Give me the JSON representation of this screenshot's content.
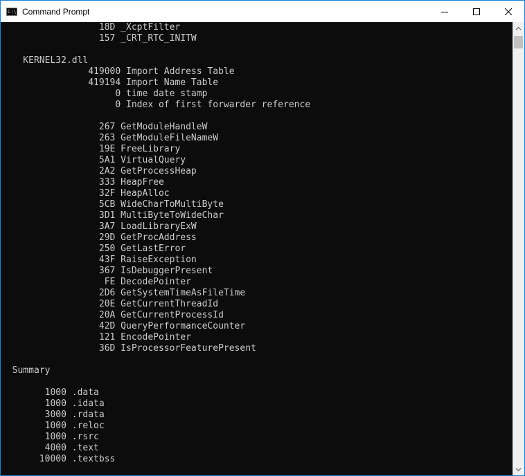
{
  "window": {
    "title": "Command Prompt",
    "app_icon_text": "C:\\"
  },
  "controls": {
    "minimize": "minimize-icon",
    "maximize": "maximize-icon",
    "close": "close-icon"
  },
  "scrollbar": {
    "position_fraction": 0.0
  },
  "console": {
    "lines": [
      "                  18D _XcptFilter",
      "                  157 _CRT_RTC_INITW",
      "",
      "    KERNEL32.dll",
      "                419000 Import Address Table",
      "                419194 Import Name Table",
      "                     0 time date stamp",
      "                     0 Index of first forwarder reference",
      "",
      "                  267 GetModuleHandleW",
      "                  263 GetModuleFileNameW",
      "                  19E FreeLibrary",
      "                  5A1 VirtualQuery",
      "                  2A2 GetProcessHeap",
      "                  333 HeapFree",
      "                  32F HeapAlloc",
      "                  5CB WideCharToMultiByte",
      "                  3D1 MultiByteToWideChar",
      "                  3A7 LoadLibraryExW",
      "                  29D GetProcAddress",
      "                  250 GetLastError",
      "                  43F RaiseException",
      "                  367 IsDebuggerPresent",
      "                   FE DecodePointer",
      "                  2D6 GetSystemTimeAsFileTime",
      "                  20E GetCurrentThreadId",
      "                  20A GetCurrentProcessId",
      "                  42D QueryPerformanceCounter",
      "                  121 EncodePointer",
      "                  36D IsProcessorFeaturePresent",
      "",
      "  Summary",
      "",
      "        1000 .data",
      "        1000 .idata",
      "        3000 .rdata",
      "        1000 .reloc",
      "        1000 .rsrc",
      "        4000 .text",
      "       10000 .textbss"
    ]
  }
}
